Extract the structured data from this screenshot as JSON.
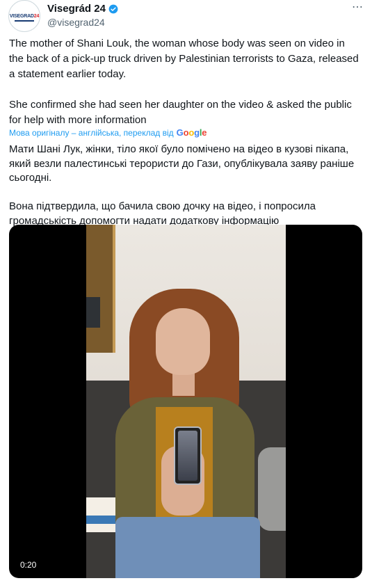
{
  "author": {
    "name": "Visegrád 24",
    "handle": "@visegrad24",
    "avatar_label_left": "VISEGRAD",
    "avatar_label_num": "24",
    "verified_icon": "verified-badge-icon",
    "more_icon": "more-dots-icon"
  },
  "tweet": {
    "text": "The mother of Shani Louk, the woman whose body was seen on video in the back of a pick-up truck driven by Palestinian terrorists to Gaza, released a statement earlier today.\n\nShe confirmed she had seen her daughter on the video & asked the public for help with more information"
  },
  "translation": {
    "label": "Мова оригіналу – англійська, переклад від",
    "provider": "Google",
    "text": "Мати Шані Лук, жінки, тіло якої було помічено на відео в кузові пікапа, який везли палестинські терористи до Гази, опублікувала заяву раніше сьогодні.\n\nВона підтвердила, що бачила свою дочку на відео, і попросила громадськість допомогти надати додаткову інформацію"
  },
  "video": {
    "timestamp": "0:20"
  },
  "colors": {
    "link": "#1d9bf0",
    "text": "#0f1419",
    "secondary": "#536471"
  }
}
